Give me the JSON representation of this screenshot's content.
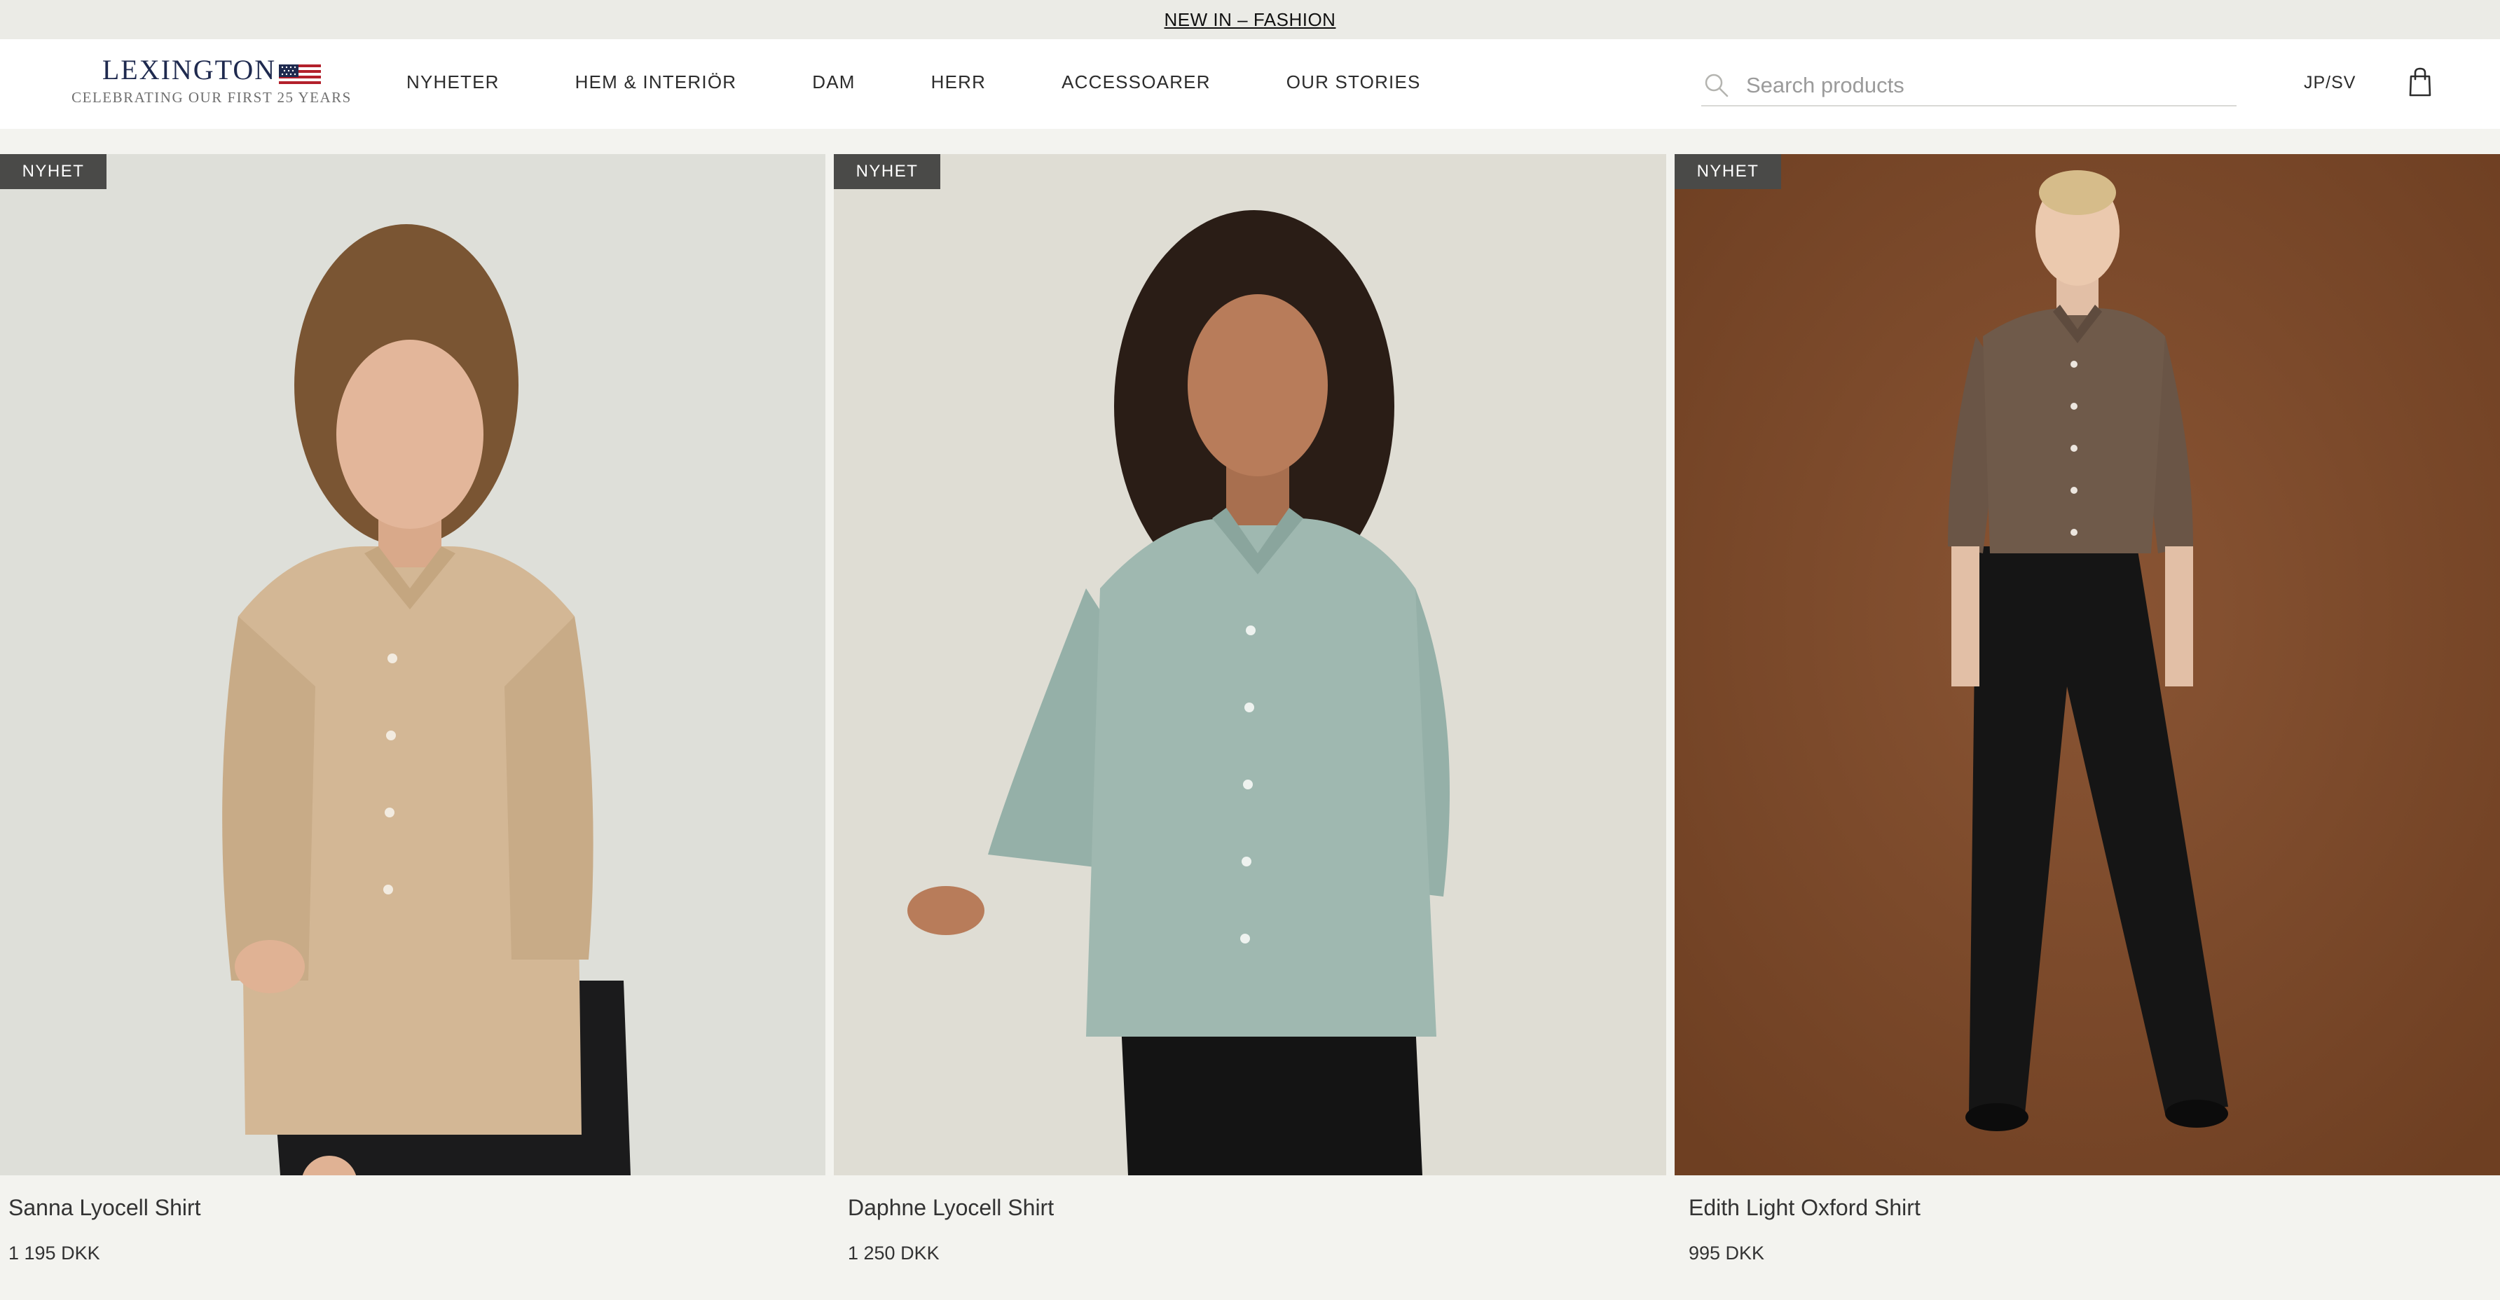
{
  "announcement": {
    "text": "NEW IN – FASHION "
  },
  "brand": {
    "name": "LEXINGTON",
    "tagline": "CELEBRATING OUR FIRST 25 YEARS"
  },
  "nav": {
    "items": [
      {
        "label": "NYHETER"
      },
      {
        "label": "HEM & INTERIÖR"
      },
      {
        "label": "DAM"
      },
      {
        "label": "HERR"
      },
      {
        "label": "ACCESSOARER"
      },
      {
        "label": "OUR STORIES"
      }
    ]
  },
  "search": {
    "placeholder": "Search products",
    "value": ""
  },
  "locale": {
    "label": "JP/SV"
  },
  "products": [
    {
      "badge": "NYHET",
      "name": "Sanna Lyocell Shirt",
      "price": "1 195 DKK",
      "bg": "#dfded9",
      "shirt": "#d3b795"
    },
    {
      "badge": "NYHET",
      "name": "Daphne Lyocell Shirt",
      "price": "1 250 DKK",
      "bg": "#dedcd3",
      "shirt": "#9fb8b0"
    },
    {
      "badge": "NYHET",
      "name": "Edith Light Oxford Shirt",
      "price": "995 DKK",
      "bg": "#7e4a2c",
      "shirt": "#6f5a4a"
    }
  ],
  "colors": {
    "background": "#f3f3ef",
    "header": "#ffffff",
    "badge": "#4a4a48",
    "brand_navy": "#1f2a4f"
  }
}
